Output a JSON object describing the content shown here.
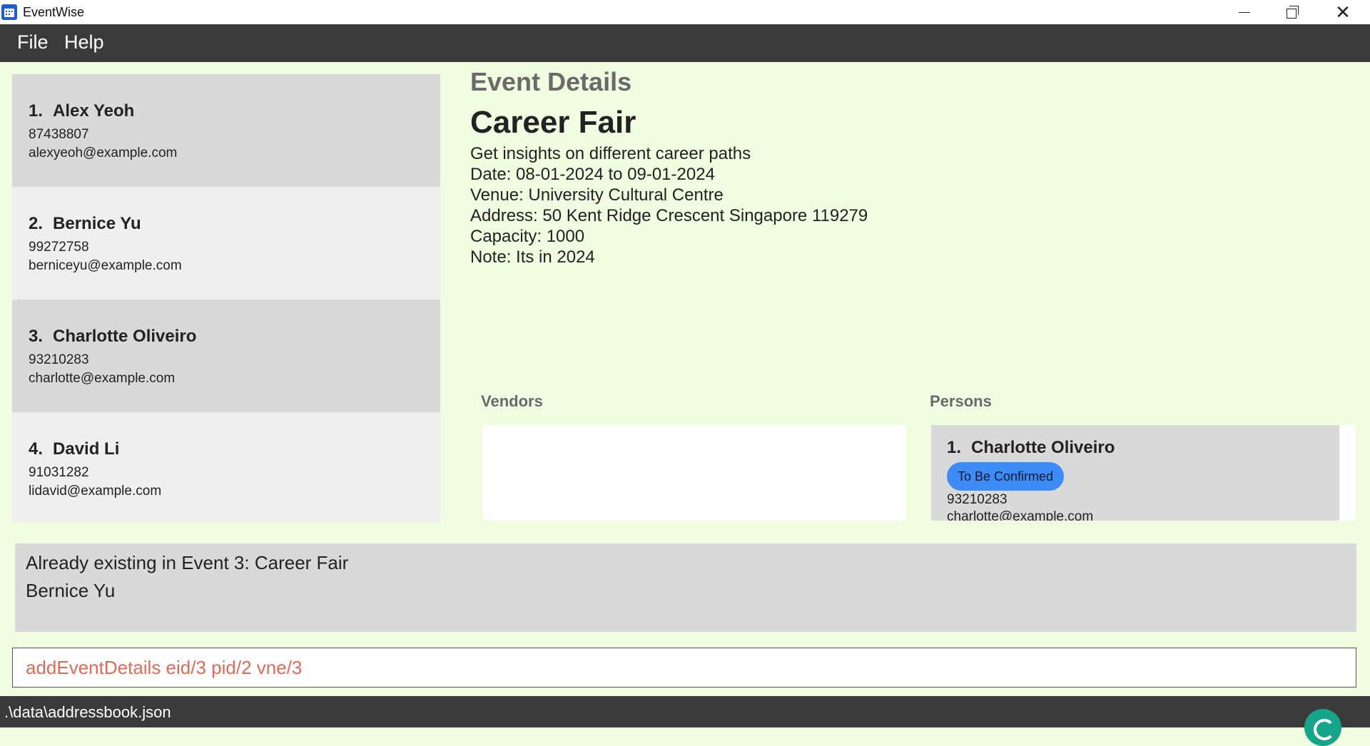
{
  "window": {
    "title": "EventWise",
    "icons": {
      "app": "calendar-icon",
      "minimize": "minimize-icon",
      "maximize": "restore-icon",
      "close": "close-icon"
    }
  },
  "menu": {
    "items": [
      {
        "label": "File"
      },
      {
        "label": "Help"
      }
    ]
  },
  "persons": [
    {
      "index": "1.",
      "name": "Alex Yeoh",
      "phone": "87438807",
      "email": "alexyeoh@example.com"
    },
    {
      "index": "2.",
      "name": "Bernice Yu",
      "phone": "99272758",
      "email": "berniceyu@example.com"
    },
    {
      "index": "3.",
      "name": "Charlotte Oliveiro",
      "phone": "93210283",
      "email": "charlotte@example.com"
    },
    {
      "index": "4.",
      "name": "David Li",
      "phone": "91031282",
      "email": "lidavid@example.com"
    }
  ],
  "event_details": {
    "heading": "Event Details",
    "name": "Career Fair",
    "description": "Get insights on different career paths",
    "date": "Date: 08-01-2024 to 09-01-2024",
    "venue": "Venue: University Cultural Centre",
    "address": "Address: 50 Kent Ridge Crescent Singapore 119279",
    "capacity": "Capacity: 1000",
    "note": "Note: Its in 2024",
    "vendors_label": "Vendors",
    "persons_label": "Persons",
    "event_persons": [
      {
        "index": "1.",
        "name": "Charlotte Oliveiro",
        "tag": "To Be Confirmed",
        "phone": "93210283",
        "email": "charlotte@example.com"
      }
    ]
  },
  "result": {
    "line1": "Already existing in Event 3: Career Fair",
    "line2": "Bernice Yu"
  },
  "command": {
    "value": "addEventDetails eid/3 pid/2 vne/3"
  },
  "status": {
    "file_path": ".\\data\\addressbook.json"
  },
  "colors": {
    "background": "#f0fde0",
    "menubar": "#3a3a3a",
    "card_odd": "#d9d9d9",
    "card_even": "#efefef",
    "tag": "#3d8cf5",
    "command_text": "#e06a55"
  }
}
